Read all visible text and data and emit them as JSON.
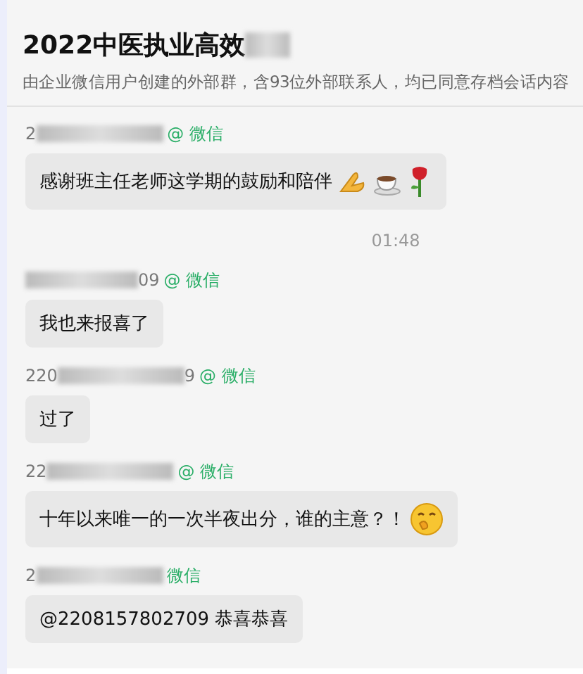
{
  "header": {
    "title": "2022中医执业高效",
    "subtitle": "由企业微信用户创建的外部群，含93位外部联系人，均已同意存档会话内容"
  },
  "messages": [
    {
      "kind": "message",
      "name_start": "2",
      "source": "@ 微信",
      "text": "感谢班主任老师这学期的鼓励和陪伴",
      "icons": [
        {
          "kind": "pray"
        },
        {
          "kind": "coffee"
        },
        {
          "kind": "rose"
        }
      ]
    },
    {
      "kind": "time",
      "text": "01:48"
    },
    {
      "kind": "message",
      "name_end": "09",
      "source": "@ 微信",
      "text": "我也来报喜了"
    },
    {
      "kind": "message",
      "name_start": "220",
      "name_end": "9",
      "source": "@ 微信",
      "text": "过了"
    },
    {
      "kind": "message",
      "name_start": "22",
      "source": "@ 微信",
      "text": "十年以来唯一的一次半夜出分，谁的主意？！",
      "icons": [
        {
          "kind": "giggle"
        }
      ]
    },
    {
      "kind": "message",
      "name_start": "2",
      "source": "微信",
      "text": "@2208157802709 恭喜恭喜"
    }
  ]
}
